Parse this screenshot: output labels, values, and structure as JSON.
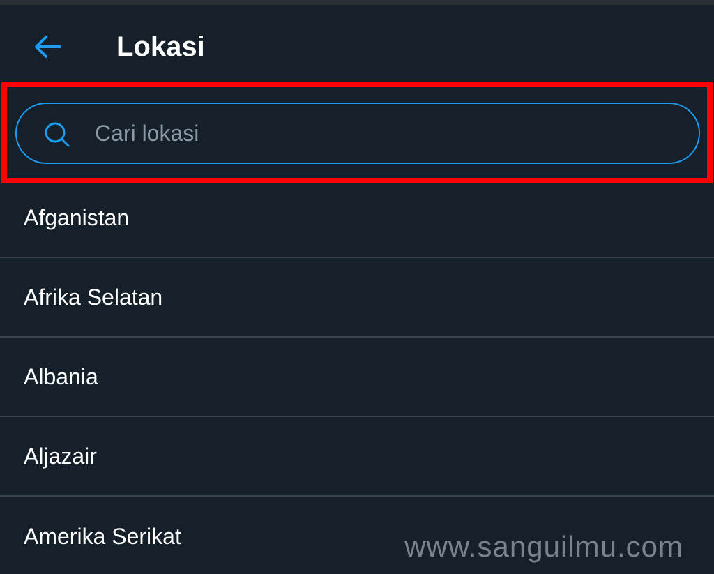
{
  "header": {
    "title": "Lokasi",
    "back_icon": "arrow-left-icon"
  },
  "search": {
    "placeholder": "Cari lokasi",
    "value": "",
    "icon": "search-icon"
  },
  "locations": [
    {
      "label": "Afganistan"
    },
    {
      "label": "Afrika Selatan"
    },
    {
      "label": "Albania"
    },
    {
      "label": "Aljazair"
    },
    {
      "label": "Amerika Serikat"
    }
  ],
  "watermark": "www.sanguilmu.com",
  "colors": {
    "background": "#15202b",
    "accent": "#1d9bf0",
    "highlight": "#ff0000",
    "divider": "#38444d",
    "placeholder": "#8b98a5"
  }
}
